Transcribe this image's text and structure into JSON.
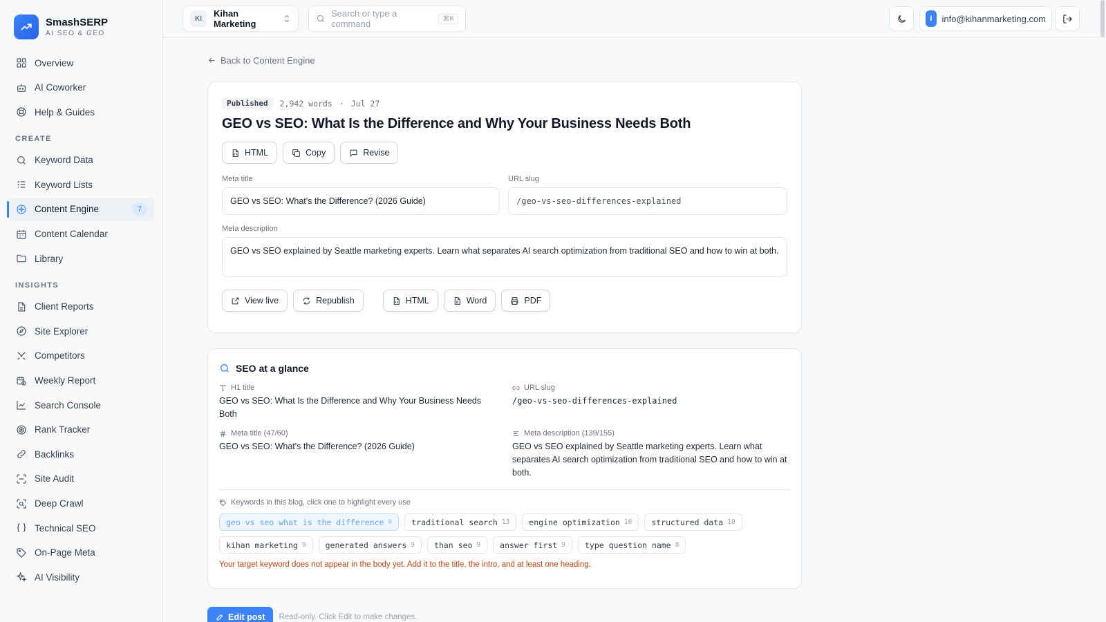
{
  "brand": {
    "name": "SmashSERP",
    "subtitle": "AI SEO & GEO"
  },
  "nav": {
    "top": [
      {
        "label": "Overview",
        "icon": "grid-icon"
      },
      {
        "label": "AI Coworker",
        "icon": "robot-icon"
      },
      {
        "label": "Help & Guides",
        "icon": "lifebuoy-icon"
      }
    ],
    "create_label": "CREATE",
    "create": [
      {
        "label": "Keyword Data",
        "icon": "search-icon"
      },
      {
        "label": "Keyword Lists",
        "icon": "list-icon"
      },
      {
        "label": "Content Engine",
        "icon": "sparkle-icon",
        "badge": "7",
        "active": true
      },
      {
        "label": "Content Calendar",
        "icon": "calendar-icon"
      },
      {
        "label": "Library",
        "icon": "folder-icon"
      }
    ],
    "insights_label": "INSIGHTS",
    "insights": [
      {
        "label": "Client Reports",
        "icon": "file-icon"
      },
      {
        "label": "Site Explorer",
        "icon": "compass-icon"
      },
      {
        "label": "Competitors",
        "icon": "swords-icon"
      },
      {
        "label": "Weekly Report",
        "icon": "calendar-clock-icon"
      },
      {
        "label": "Search Console",
        "icon": "line-chart-icon"
      },
      {
        "label": "Rank Tracker",
        "icon": "target-icon"
      },
      {
        "label": "Backlinks",
        "icon": "link-icon"
      },
      {
        "label": "Site Audit",
        "icon": "scan-icon"
      },
      {
        "label": "Deep Crawl",
        "icon": "scan-search-icon"
      },
      {
        "label": "Technical SEO",
        "icon": "braces-icon"
      },
      {
        "label": "On-Page Meta",
        "icon": "tag-icon"
      },
      {
        "label": "AI Visibility",
        "icon": "sparkles-icon"
      }
    ]
  },
  "topbar": {
    "workspace_initials": "KI",
    "workspace_name": "Kihan Marketing",
    "search_placeholder": "Search or type a command",
    "search_shortcut": "⌘K",
    "user_initial": "I",
    "user_email": "info@kihanmarketing.com"
  },
  "back_link": "Back to Content Engine",
  "post": {
    "status": "Published",
    "words": "2,942 words",
    "separator": "·",
    "date": "Jul 27",
    "title": "GEO vs SEO: What Is the Difference and Why Your Business Needs Both",
    "actions": [
      "HTML",
      "Copy",
      "Revise"
    ],
    "meta_title_label": "Meta title",
    "meta_title": "GEO vs SEO: What's the Difference? (2026 Guide)",
    "url_slug_label": "URL slug",
    "url_slug": "/geo-vs-seo-differences-explained",
    "meta_description_label": "Meta description",
    "meta_description": "GEO vs SEO explained by Seattle marketing experts. Learn what separates AI search optimization from traditional SEO and how to win at both.",
    "bottom_actions": {
      "view_live": "View live",
      "republish": "Republish",
      "html": "HTML",
      "word": "Word",
      "pdf": "PDF"
    }
  },
  "glance": {
    "title": "SEO at a glance",
    "h1_label": "H1 title",
    "h1": "GEO vs SEO: What Is the Difference and Why Your Business Needs Both",
    "slug_label": "URL slug",
    "slug": "/geo-vs-seo-differences-explained",
    "meta_title_label": "Meta title (47/60)",
    "meta_title": "GEO vs SEO: What's the Difference? (2026 Guide)",
    "meta_desc_label": "Meta description (139/155)",
    "meta_desc": "GEO vs SEO explained by Seattle marketing experts. Learn what separates AI search optimization from traditional SEO and how to win at both.",
    "keywords_hint": "Keywords in this blog, click one to highlight every use",
    "keywords": [
      {
        "text": "geo vs seo what is the difference",
        "count": "0",
        "active": true
      },
      {
        "text": "traditional search",
        "count": "13"
      },
      {
        "text": "engine optimization",
        "count": "10"
      },
      {
        "text": "structured data",
        "count": "10"
      },
      {
        "text": "kihan marketing",
        "count": "9"
      },
      {
        "text": "generated answers",
        "count": "9"
      },
      {
        "text": "than seo",
        "count": "9"
      },
      {
        "text": "answer first",
        "count": "9"
      },
      {
        "text": "type question name",
        "count": "8"
      }
    ],
    "warning": "Your target keyword does not appear in the body yet. Add it to the title, the intro, and at least one heading."
  },
  "edit": {
    "button": "Edit post",
    "note": "Read-only. Click Edit to make changes."
  },
  "colors": {
    "accent": "#3b82f6",
    "warning": "#c2410c"
  }
}
